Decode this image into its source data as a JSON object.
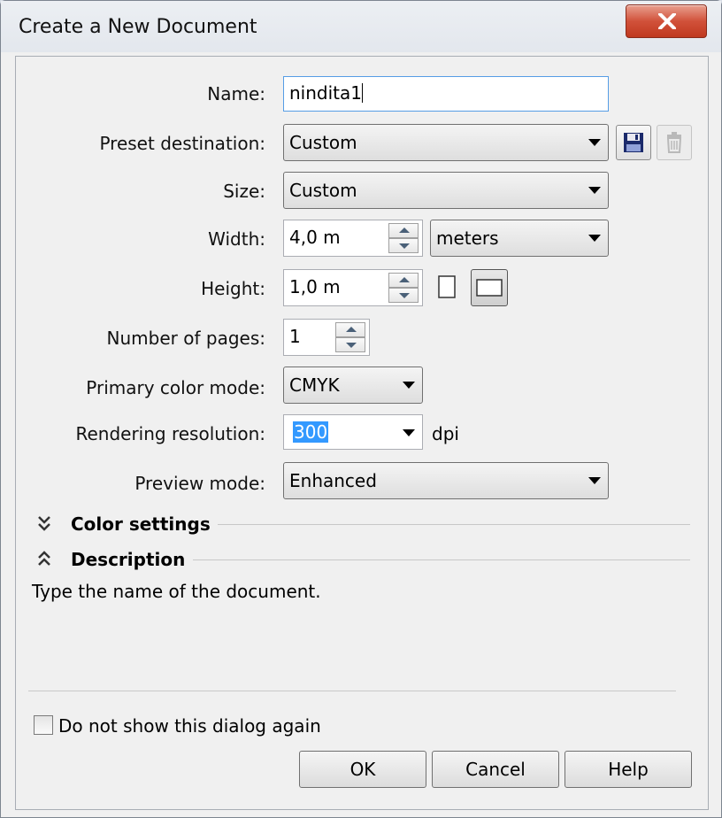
{
  "window": {
    "title": "Create a New Document"
  },
  "form": {
    "name": {
      "label": "Name:",
      "value": "nindita1"
    },
    "preset_destination": {
      "label": "Preset destination:",
      "value": "Custom"
    },
    "size": {
      "label": "Size:",
      "value": "Custom"
    },
    "width": {
      "label": "Width:",
      "value": "4,0 m",
      "unit": "meters"
    },
    "height": {
      "label": "Height:",
      "value": "1,0 m",
      "orientation": "landscape"
    },
    "pages": {
      "label": "Number of pages:",
      "value": "1"
    },
    "color_mode": {
      "label": "Primary color mode:",
      "value": "CMYK"
    },
    "resolution": {
      "label": "Rendering resolution:",
      "value": "300",
      "unit": "dpi"
    },
    "preview_mode": {
      "label": "Preview mode:",
      "value": "Enhanced"
    }
  },
  "sections": {
    "color_settings": {
      "label": "Color settings",
      "state": "collapsed"
    },
    "description": {
      "label": "Description",
      "state": "expanded",
      "text": "Type the name of the document."
    }
  },
  "footer": {
    "dont_show_label": "Do not show this dialog again",
    "dont_show_checked": false,
    "ok_label": "OK",
    "cancel_label": "Cancel",
    "help_label": "Help"
  },
  "colors": {
    "close_button": "#c0391f",
    "selection": "#3399ff",
    "focus_border": "#569de5"
  },
  "icons": {
    "save_preset": "floppy-disk-icon",
    "delete_preset": "trash-icon",
    "close": "close-icon"
  }
}
